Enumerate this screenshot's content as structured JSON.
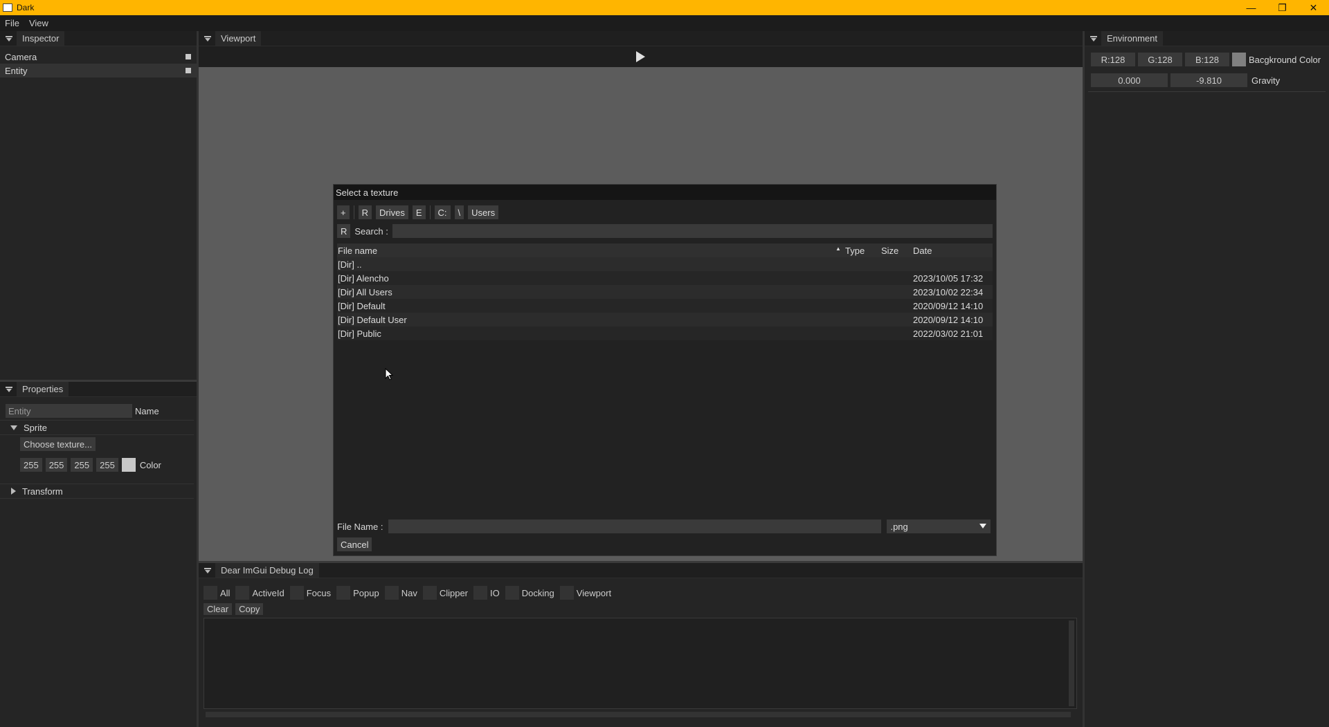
{
  "window": {
    "title": "Dark",
    "minimize_glyph": "—",
    "restore_glyph": "❐",
    "close_glyph": "✕"
  },
  "menu": {
    "file": "File",
    "view": "View"
  },
  "inspector": {
    "title": "Inspector",
    "items": [
      "Camera",
      "Entity"
    ]
  },
  "properties": {
    "title": "Properties",
    "entity_value": "Entity",
    "name_label": "Name",
    "sprite_label": "Sprite",
    "choose_texture_label": "Choose texture...",
    "color_values": [
      "255",
      "255",
      "255",
      "255"
    ],
    "color_label": "Color",
    "color_swatch": "#ffffff",
    "transform_label": "Transform"
  },
  "viewport": {
    "title": "Viewport",
    "background": "#5c5c5c"
  },
  "environment": {
    "title": "Environment",
    "r": "R:128",
    "g": "G:128",
    "b": "B:128",
    "background_color_label": "Bacgkround Color",
    "background_swatch": "#808080",
    "gravity_x": "0.000",
    "gravity_y": "-9.810",
    "gravity_label": "Gravity"
  },
  "dialog": {
    "title": "Select a texture",
    "toolbar": {
      "add": "+",
      "r1": "R",
      "drives": "Drives",
      "e": "E",
      "c_drive": "C:",
      "backslash": "\\",
      "users": "Users"
    },
    "search_r": "R",
    "search_label": "Search :",
    "search_value": "",
    "columns": {
      "name": "File name",
      "type": "Type",
      "size": "Size",
      "date": "Date"
    },
    "files": [
      {
        "name": "[Dir] ..",
        "type": "",
        "size": "",
        "date": ""
      },
      {
        "name": "[Dir] Alencho",
        "type": "",
        "size": "",
        "date": "2023/10/05 17:32"
      },
      {
        "name": "[Dir] All Users",
        "type": "",
        "size": "",
        "date": "2023/10/02 22:34"
      },
      {
        "name": "[Dir] Default",
        "type": "",
        "size": "",
        "date": "2020/09/12 14:10"
      },
      {
        "name": "[Dir] Default User",
        "type": "",
        "size": "",
        "date": "2020/09/12 14:10"
      },
      {
        "name": "[Dir] Public",
        "type": "",
        "size": "",
        "date": "2022/03/02 21:01"
      }
    ],
    "file_name_label": "File Name :",
    "file_name_value": "",
    "extension": ".png",
    "cancel_label": "Cancel"
  },
  "debug_log": {
    "title": "Dear ImGui Debug Log",
    "checks": [
      "All",
      "ActiveId",
      "Focus",
      "Popup",
      "Nav",
      "Clipper",
      "IO",
      "Docking",
      "Viewport"
    ],
    "clear_label": "Clear",
    "copy_label": "Copy"
  },
  "colors": {
    "title_bar": "#ffb500",
    "panel_bg": "#252525"
  }
}
